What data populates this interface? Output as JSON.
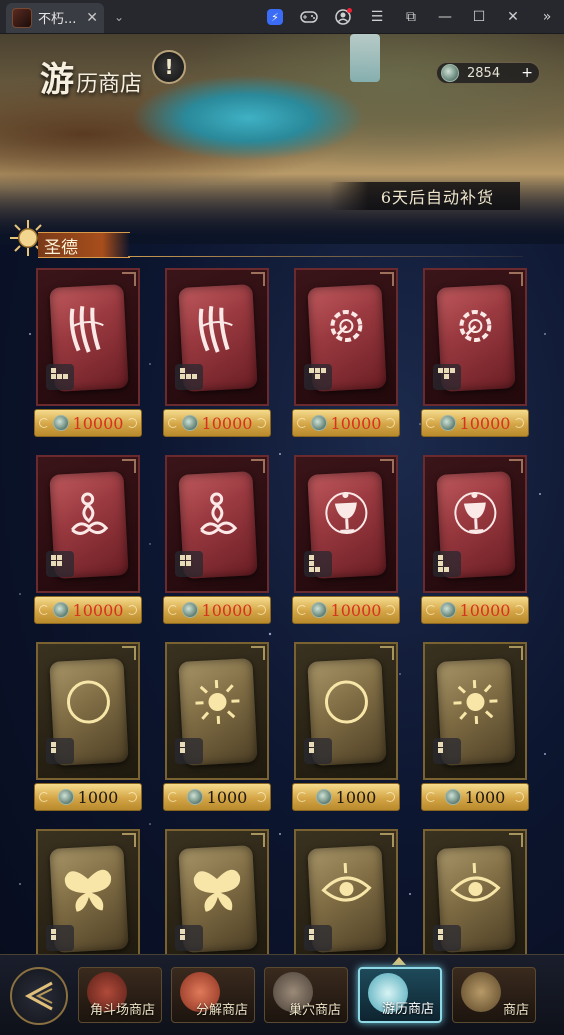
{
  "window": {
    "tab_title": "不朽...",
    "icons": [
      "boost-icon",
      "gamepad-icon",
      "user-icon",
      "menu-icon",
      "popout-icon",
      "minimize-icon",
      "maximize-icon",
      "close-icon",
      "sidebar-toggle-icon"
    ]
  },
  "header": {
    "title_big": "游",
    "title_rest": "历商店",
    "info_label": "!",
    "currency_amount": "2854",
    "currency_plus": "+",
    "restock_text": "6天后自动补货"
  },
  "section": {
    "label": "圣德"
  },
  "items": [
    {
      "theme": "red",
      "glyph": "claw",
      "price": "10000"
    },
    {
      "theme": "red",
      "glyph": "claw",
      "price": "10000"
    },
    {
      "theme": "red",
      "glyph": "cog",
      "price": "10000"
    },
    {
      "theme": "red",
      "glyph": "cog",
      "price": "10000"
    },
    {
      "theme": "red",
      "glyph": "meditate",
      "price": "10000"
    },
    {
      "theme": "red",
      "glyph": "meditate",
      "price": "10000"
    },
    {
      "theme": "red",
      "glyph": "chalice",
      "price": "10000"
    },
    {
      "theme": "red",
      "glyph": "chalice",
      "price": "10000"
    },
    {
      "theme": "gold",
      "glyph": "moon",
      "price": "1000"
    },
    {
      "theme": "gold",
      "glyph": "sun",
      "price": "1000"
    },
    {
      "theme": "gold",
      "glyph": "moon",
      "price": "1000"
    },
    {
      "theme": "gold",
      "glyph": "sun",
      "price": "1000"
    },
    {
      "theme": "gold",
      "glyph": "butterfly",
      "price": ""
    },
    {
      "theme": "gold",
      "glyph": "butterfly",
      "price": ""
    },
    {
      "theme": "gold",
      "glyph": "eye",
      "price": ""
    },
    {
      "theme": "gold",
      "glyph": "eye",
      "price": ""
    }
  ],
  "nav": {
    "tabs": [
      {
        "label": "角斗场商店",
        "active": false
      },
      {
        "label": "分解商店",
        "active": false
      },
      {
        "label": "巢穴商店",
        "active": false
      },
      {
        "label": "游历商店",
        "active": true
      },
      {
        "label": "商店",
        "active": false
      }
    ]
  },
  "colors": {
    "accent_gold": "#d4a546",
    "price_red": "#d8321e",
    "active_tab_glow": "#8fd8e6"
  }
}
